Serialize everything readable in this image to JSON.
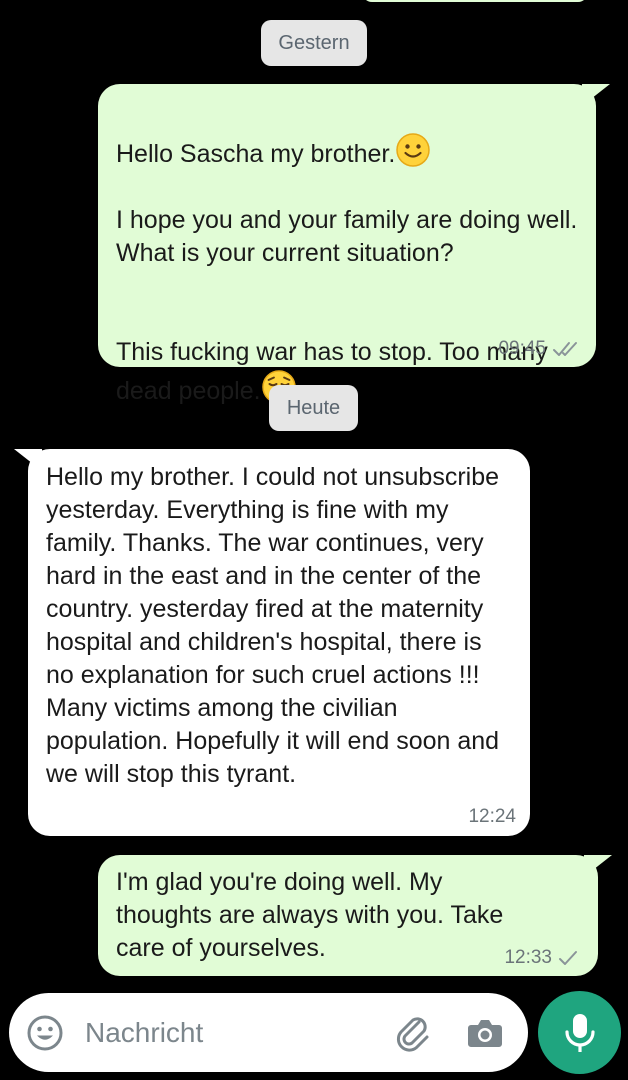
{
  "chat": {
    "date_separators": [
      "Gestern",
      "Heute"
    ],
    "messages": [
      {
        "direction": "outgoing",
        "paragraphs": [
          "Hello Sascha my brother.",
          " I hope you and your family are doing well. What is your current situation?",
          "This fucking war has to stop. Too many dead people."
        ],
        "emojis": [
          "slightly-smiling-face",
          "pensive-face"
        ],
        "time": "09:45",
        "status": "read"
      },
      {
        "direction": "incoming",
        "text": "Hello my brother. I could not unsubscribe yesterday. Everything is fine with my family. Thanks. The war continues, very hard in the east and in the center of the country. yesterday fired at the maternity hospital and children's hospital, there is no explanation for such cruel actions !!! Many victims among the civilian population. Hopefully it will end soon and we will stop this tyrant.",
        "time": "12:24"
      },
      {
        "direction": "outgoing",
        "text": "I'm glad you're doing well. My thoughts are always with you. Take care of yourselves.",
        "time": "12:33",
        "status": "sent"
      }
    ]
  },
  "composer": {
    "placeholder": "Nachricht",
    "icons": [
      "emoji-icon",
      "paperclip-icon",
      "camera-icon",
      "microphone-icon"
    ]
  },
  "colors": {
    "background": "#000000",
    "outgoing_bubble": "#e1fcd6",
    "incoming_bubble": "#ffffff",
    "accent": "#1fa57f",
    "read_check": "#8a9499"
  }
}
